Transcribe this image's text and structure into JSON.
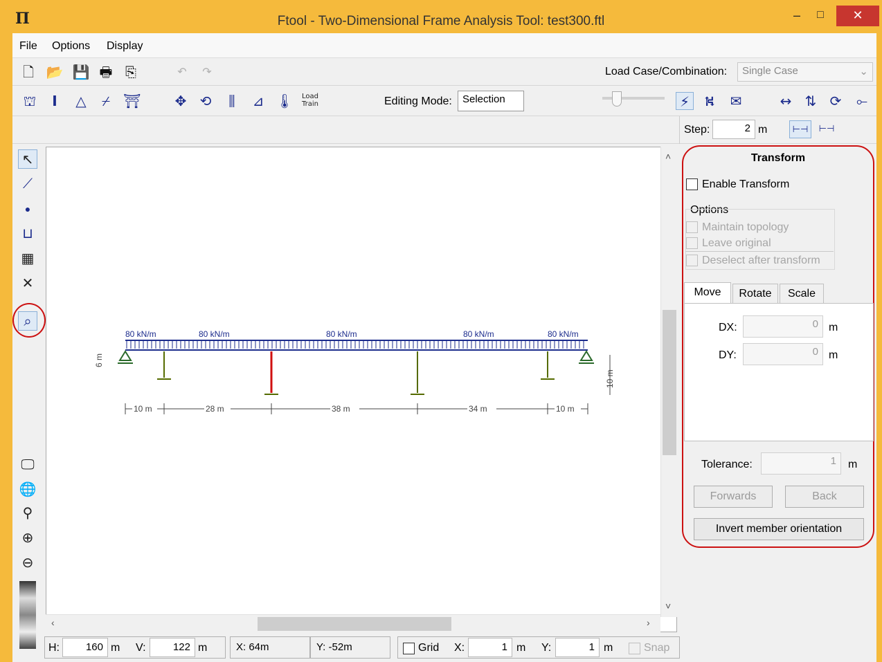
{
  "window": {
    "title": "Ftool - Two-Dimensional Frame Analysis Tool: test300.ftl",
    "app_icon": "Π",
    "min_glyph": "–",
    "max_glyph": "□",
    "close_glyph": "✕"
  },
  "menu": [
    "File",
    "Options",
    "Display"
  ],
  "toolbar1": {
    "load_case_label": "Load Case/Combination:",
    "load_case_value": "Single Case"
  },
  "toolbar2": {
    "load_train_label": "Load Train",
    "editing_mode_label": "Editing Mode:",
    "editing_mode_value": "Selection"
  },
  "toolbar3": {
    "step_label": "Step:",
    "step_value": "2",
    "step_unit": "m"
  },
  "drawing": {
    "loads": [
      "80 kN/m",
      "80 kN/m",
      "80 kN/m",
      "80 kN/m",
      "80 kN/m"
    ],
    "spans": [
      "10 m",
      "28 m",
      "38 m",
      "34 m",
      "10 m"
    ],
    "left_height": "6 m",
    "right_height": "10 m"
  },
  "status": {
    "h_label": "H:",
    "h_value": "160",
    "h_unit": "m",
    "v_label": "V:",
    "v_value": "122",
    "v_unit": "m",
    "x_coord": "X: 64m",
    "y_coord": "Y: -52m",
    "grid_label": "Grid",
    "gx_label": "X:",
    "gx_value": "1",
    "gx_unit": "m",
    "gy_label": "Y:",
    "gy_value": "1",
    "gy_unit": "m",
    "snap_label": "Snap"
  },
  "transform": {
    "title": "Transform",
    "enable_label": "Enable Transform",
    "options_label": "Options",
    "maintain_topology": "Maintain topology",
    "leave_original": "Leave original",
    "deselect_after": "Deselect after transform",
    "tabs": [
      "Move",
      "Rotate",
      "Scale"
    ],
    "dx_label": "DX:",
    "dx_value": "0",
    "dx_unit": "m",
    "dy_label": "DY:",
    "dy_value": "0",
    "dy_unit": "m",
    "tolerance_label": "Tolerance:",
    "tolerance_value": "1",
    "tolerance_unit": "m",
    "forwards": "Forwards",
    "back": "Back",
    "invert": "Invert member orientation"
  }
}
